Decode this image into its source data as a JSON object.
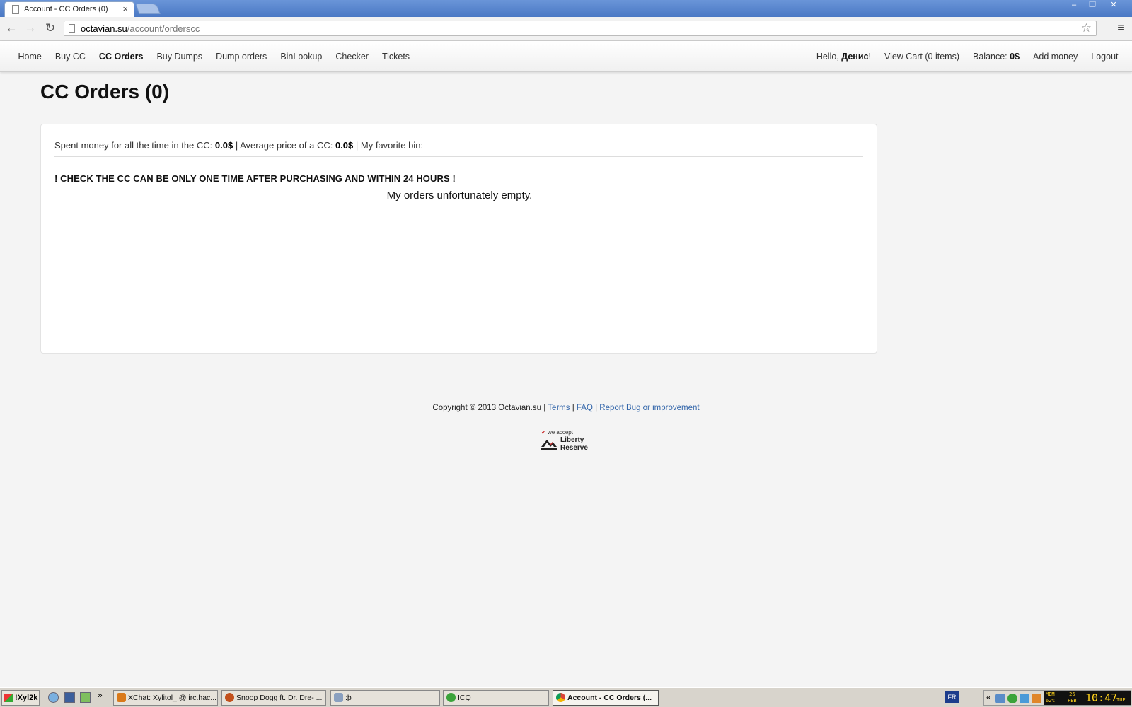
{
  "browser": {
    "tab_title": "Account - CC Orders (0)",
    "url_host": "octavian.su",
    "url_path": "/account/orderscc"
  },
  "nav": {
    "left": [
      "Home",
      "Buy CC",
      "CC Orders",
      "Buy Dumps",
      "Dump orders",
      "BinLookup",
      "Checker",
      "Tickets"
    ],
    "active": "CC Orders",
    "hello_prefix": "Hello, ",
    "user_name": "Денис",
    "hello_suffix": "!",
    "cart": "View Cart (0 items)",
    "balance_label": "Balance: ",
    "balance_value": "0$",
    "add_money": "Add money",
    "logout": "Logout"
  },
  "page": {
    "title": "CC Orders (0)",
    "spent_label": "Spent money for all the time in the CC: ",
    "spent_value": "0.0$",
    "sep1": " | Average price of a CC: ",
    "avg_value": "0.0$",
    "sep2": " | ",
    "fav_bin_label": "My favorite bin:",
    "warning": "! CHECK THE CC CAN BE ONLY ONE TIME AFTER PURCHASING AND WITHIN 24 HOURS !",
    "empty_message": "My orders unfortunately empty."
  },
  "footer": {
    "copyright": "Copyright © 2013 Octavian.su | ",
    "terms": "Terms",
    "sep": " | ",
    "faq": "FAQ",
    "report": "Report Bug or improvement",
    "badge_accept": "we accept",
    "badge_line1": "Liberty",
    "badge_line2": "Reserve"
  },
  "taskbar": {
    "start_label": "!Xyl2k",
    "more": "»",
    "tasks": [
      {
        "label": "XChat: Xylitol_ @ irc.hac...",
        "color": "#d9791a"
      },
      {
        "label": "Snoop Dogg ft. Dr. Dre- ...",
        "color": "#c2501c"
      },
      {
        "label": ":þ",
        "color": "#8aa0c0"
      },
      {
        "label": "ICQ",
        "color": "#3aa33a"
      },
      {
        "label": "Account - CC Orders (...",
        "color": "#4285f4"
      }
    ],
    "lang": "FR",
    "tray_chevron": "«",
    "clock_mem_label": "MEM",
    "clock_mem_value": "62%",
    "clock_day_num": "26",
    "clock_month": "FEB",
    "clock_time": "10:47",
    "clock_weekday": "TUE"
  },
  "colors": {
    "link": "#3366aa",
    "titlebar": "#4a78c4",
    "clock_digits": "#ffd21c"
  }
}
